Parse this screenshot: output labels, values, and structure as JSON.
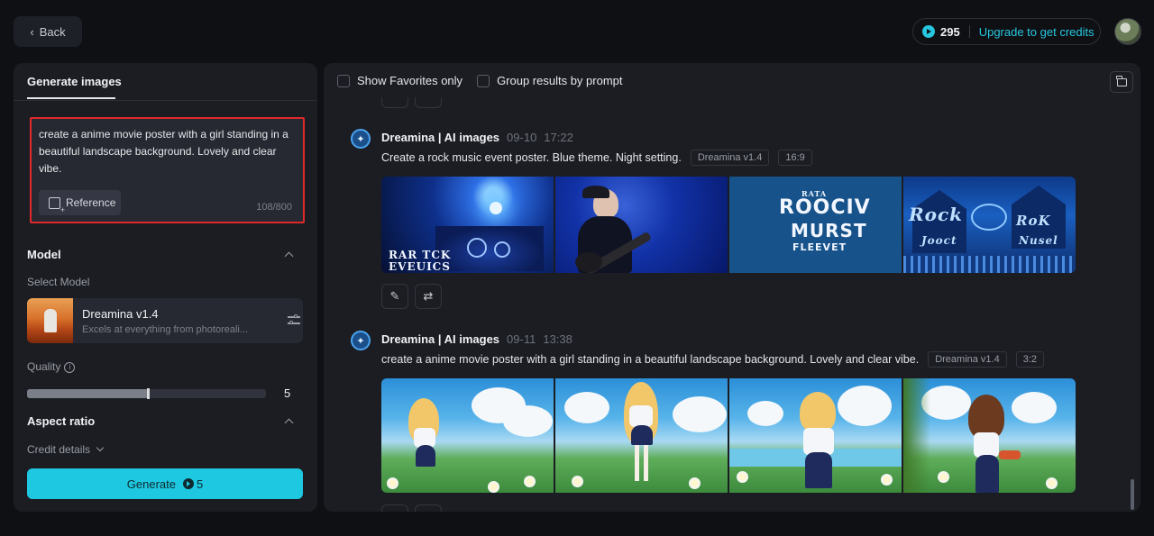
{
  "header": {
    "back_label": "Back",
    "credits": "295",
    "upgrade_label": "Upgrade to get credits"
  },
  "left_panel": {
    "tab_label": "Generate images",
    "prompt_text": "create a anime movie poster with a girl standing in a beautiful landscape background. Lovely and clear vibe.",
    "reference_label": "Reference",
    "char_count": "108/800",
    "model_section_title": "Model",
    "select_model_label": "Select Model",
    "model_name": "Dreamina v1.4",
    "model_desc": "Excels at everything from photoreali...",
    "quality_label": "Quality",
    "quality_value": "5",
    "quality_fraction": 0.5,
    "aspect_ratio_label": "Aspect ratio",
    "credit_details_label": "Credit details",
    "generate_label": "Generate",
    "generate_cost": "5"
  },
  "right_panel": {
    "filters": {
      "favorites_label": "Show Favorites only",
      "group_label": "Group results by prompt"
    },
    "generations": [
      {
        "source": "Dreamina | AI images",
        "date": "09-10",
        "time": "17:22",
        "prompt": "Create a rock music event poster. Blue theme. Night setting.",
        "model_tag": "Dreamina v1.4",
        "ratio_tag": "16:9"
      },
      {
        "source": "Dreamina | AI images",
        "date": "09-11",
        "time": "13:38",
        "prompt": "create a anime movie poster with a girl standing in a beautiful landscape background. Lovely and clear vibe.",
        "model_tag": "Dreamina v1.4",
        "ratio_tag": "3:2"
      }
    ],
    "rock_poster_texts": {
      "img1_line1": "RAR TCK",
      "img1_line2": "EVEUICS",
      "img3_line1": "RATA",
      "img3_line2": "ROOCIV",
      "img3_line3": "MURST",
      "img3_line4": "FLEEVET",
      "img4_line1": "Rock",
      "img4_line2": "RoK",
      "img4_line3": "Jooct",
      "img4_line4": "Nusel"
    }
  },
  "colors": {
    "accent": "#1ec8e0",
    "highlight_border": "#e02a2a",
    "background": "#0f1014",
    "panel": "#1b1d23"
  },
  "icons": [
    "chevron-left-icon",
    "credit-coin-icon",
    "reference-icon",
    "chevron-up-icon",
    "sliders-icon",
    "info-icon",
    "chevron-down-icon",
    "folder-icon",
    "dreamina-logo-icon",
    "edit-icon",
    "regenerate-icon"
  ]
}
